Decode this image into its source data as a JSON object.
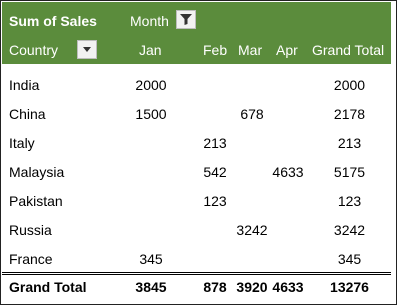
{
  "pivot": {
    "title": "Sum of Sales",
    "column_field": "Month",
    "row_field": "Country",
    "columns": [
      "Jan",
      "Feb",
      "Mar",
      "Apr",
      "Grand Total"
    ],
    "rows": [
      {
        "country": "India",
        "jan": "2000",
        "feb": "",
        "mar": "",
        "apr": "",
        "gt": "2000"
      },
      {
        "country": "China",
        "jan": "1500",
        "feb": "",
        "mar": "678",
        "apr": "",
        "gt": "2178"
      },
      {
        "country": "Italy",
        "jan": "",
        "feb": "213",
        "mar": "",
        "apr": "",
        "gt": "213"
      },
      {
        "country": "Malaysia",
        "jan": "",
        "feb": "542",
        "mar": "",
        "apr": "4633",
        "gt": "5175"
      },
      {
        "country": "Pakistan",
        "jan": "",
        "feb": "123",
        "mar": "",
        "apr": "",
        "gt": "123"
      },
      {
        "country": "Russia",
        "jan": "",
        "feb": "",
        "mar": "3242",
        "apr": "",
        "gt": "3242"
      },
      {
        "country": "France",
        "jan": "345",
        "feb": "",
        "mar": "",
        "apr": "",
        "gt": "345"
      }
    ],
    "grand_total": {
      "label": "Grand Total",
      "jan": "3845",
      "feb": "878",
      "mar": "3920",
      "apr": "4633",
      "gt": "13276"
    },
    "colors": {
      "header_bg": "#5b8c3c",
      "header_text": "#ffffff"
    },
    "icons": {
      "column_filter": "filter-icon",
      "row_dropdown": "dropdown-arrow-icon"
    }
  }
}
